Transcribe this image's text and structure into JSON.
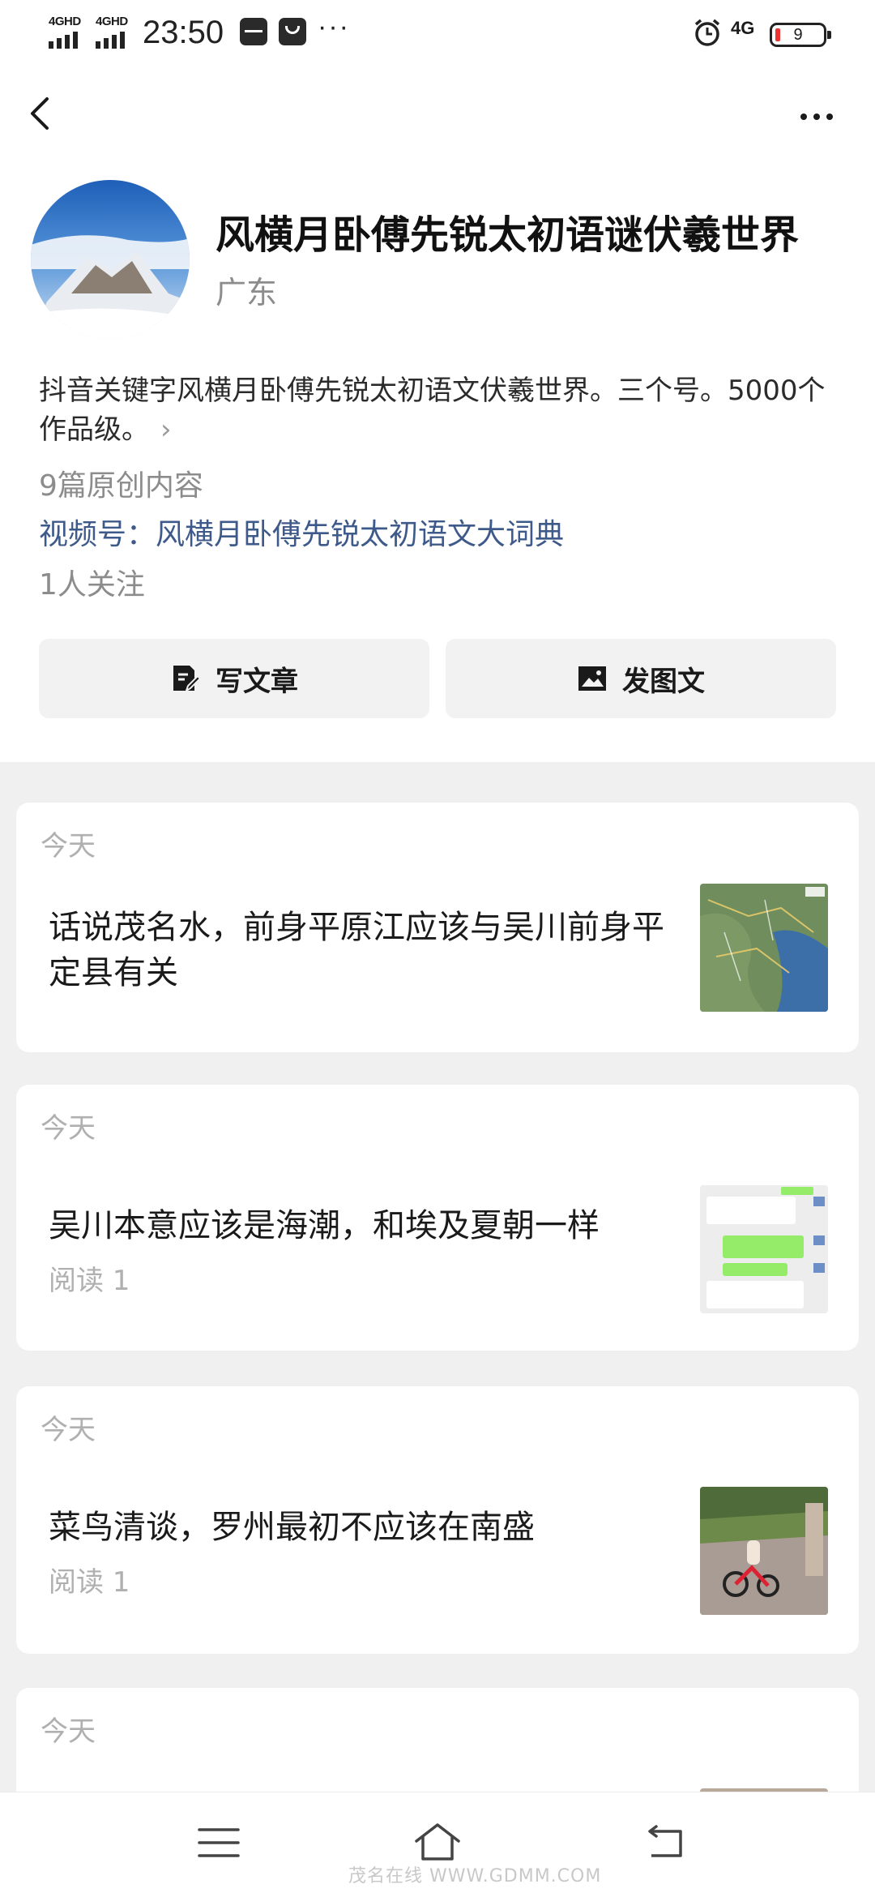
{
  "status_bar": {
    "signal_1": "4GHD",
    "signal_2": "4GHD",
    "time": "23:50",
    "more": "···",
    "network": "4G",
    "battery": "9",
    "battery_level": 0.09
  },
  "header": {
    "back_icon": "chevron-left-icon",
    "more_icon": "more-horizontal-icon"
  },
  "profile": {
    "name": "风横月卧傅先锐太初语谜伏羲世界",
    "region": "广东",
    "bio": "抖音关键字风横月卧傅先锐太初语文伏羲世界。三个号。5000个作品级。",
    "bio_chevron": "›",
    "original_count": "9篇原创内容",
    "channel": "视频号：风横月卧傅先锐太初语文大词典",
    "followers": "1人关注"
  },
  "actions": {
    "write_article": "写文章",
    "post_image_text": "发图文"
  },
  "feed": [
    {
      "date": "今天",
      "title": "话说茂名水，前身平原江应该与吴川前身平定县有关",
      "reads": ""
    },
    {
      "date": "今天",
      "title": "吴川本意应该是海潮，和埃及夏朝一样",
      "reads": "阅读 1"
    },
    {
      "date": "今天",
      "title": "菜鸟清谈，罗州最初不应该在南盛",
      "reads": "阅读 1"
    },
    {
      "date": "今天",
      "title": "",
      "reads": ""
    }
  ],
  "bottom_nav": {
    "menu_icon": "menu-icon",
    "home_icon": "home-icon",
    "back_icon": "return-icon"
  },
  "watermark": "茂名在线 WWW.GDMM.COM"
}
